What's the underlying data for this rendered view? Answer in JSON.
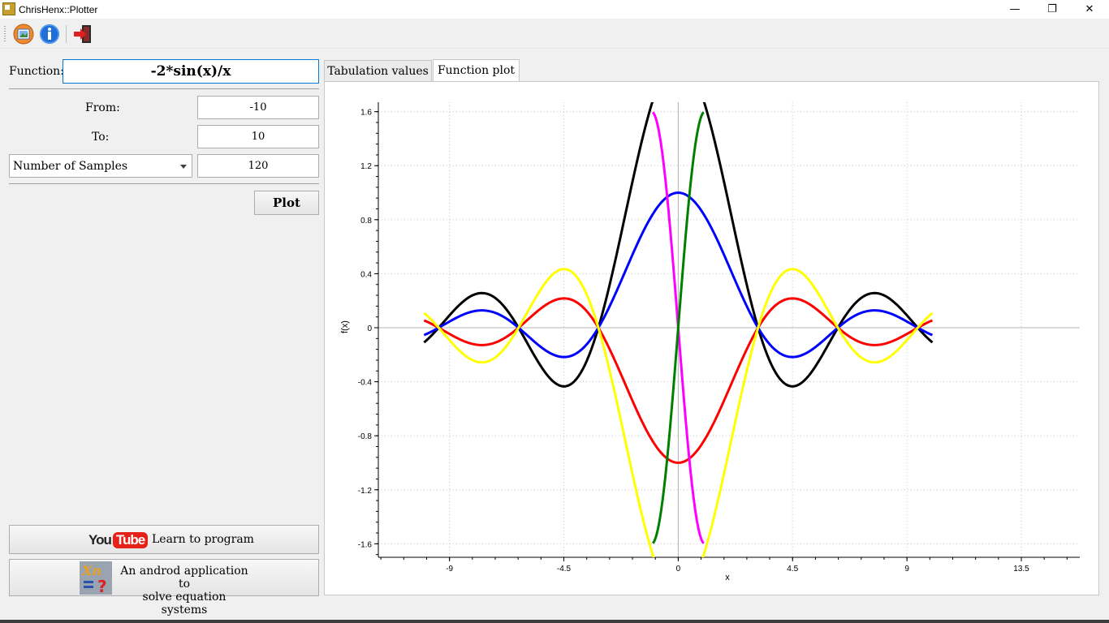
{
  "window": {
    "title": "ChrisHenx::Plotter",
    "minimize_glyph": "—",
    "maximize_glyph": "❐",
    "close_glyph": "✕"
  },
  "toolbar": {
    "icons": [
      "image-icon",
      "info-icon",
      "exit-icon"
    ]
  },
  "form": {
    "function_label": "Function:",
    "function_value": "-2*sin(x)/x",
    "from_label": "From:",
    "from_value": "-10",
    "to_label": "To:",
    "to_value": "10",
    "mode_select": "Number of Samples",
    "samples_value": "120",
    "plot_button": "Plot"
  },
  "promo": {
    "youtube_logo_you": "You",
    "youtube_logo_tube": "Tube",
    "youtube_label": "Learn to program",
    "app_label_line1": "An androd application to",
    "app_label_line2": "solve equation systems"
  },
  "tabs": {
    "tab1": "Tabulation values",
    "tab2": "Function plot",
    "active": "Function plot"
  },
  "chart_data": {
    "type": "line",
    "xlabel": "x",
    "ylabel": "f(x)",
    "xlim": [
      -11.8,
      15.8
    ],
    "ylim": [
      -1.7,
      1.67
    ],
    "x_ticks": [
      -9,
      -4.5,
      0,
      4.5,
      9,
      13.5
    ],
    "x_tick_labels": [
      "-9",
      "-4.5",
      "0",
      "4.5",
      "9",
      "13.5"
    ],
    "y_ticks": [
      1.6,
      1.2,
      0.8,
      0.4,
      0,
      -0.4,
      -0.8,
      -1.2,
      -1.6
    ],
    "y_tick_labels": [
      "1.6",
      "1.2",
      "0.8",
      "0.4",
      "0",
      "-0.4",
      "-0.8",
      "-1.2",
      "-1.6"
    ],
    "grid": true,
    "series": [
      {
        "color": "#000000",
        "expr": "2*sin(x)/x",
        "domain": [
          -10,
          10
        ]
      },
      {
        "color": "#0000ff",
        "expr": "sin(x)/x",
        "domain": [
          -10,
          10
        ]
      },
      {
        "color": "#ff0000",
        "expr": "-sin(x)/x",
        "domain": [
          -10,
          10
        ]
      },
      {
        "color": "#ffff00",
        "expr": "-2*sin(x)/x",
        "domain": [
          -10,
          10
        ]
      },
      {
        "color": "#ff00ff",
        "expr": "-1.6*sin(1.5*x)",
        "domain": [
          -1,
          1
        ]
      },
      {
        "color": "#008000",
        "expr": "1.6*sin(1.5*x)",
        "domain": [
          -1,
          1
        ]
      }
    ]
  }
}
